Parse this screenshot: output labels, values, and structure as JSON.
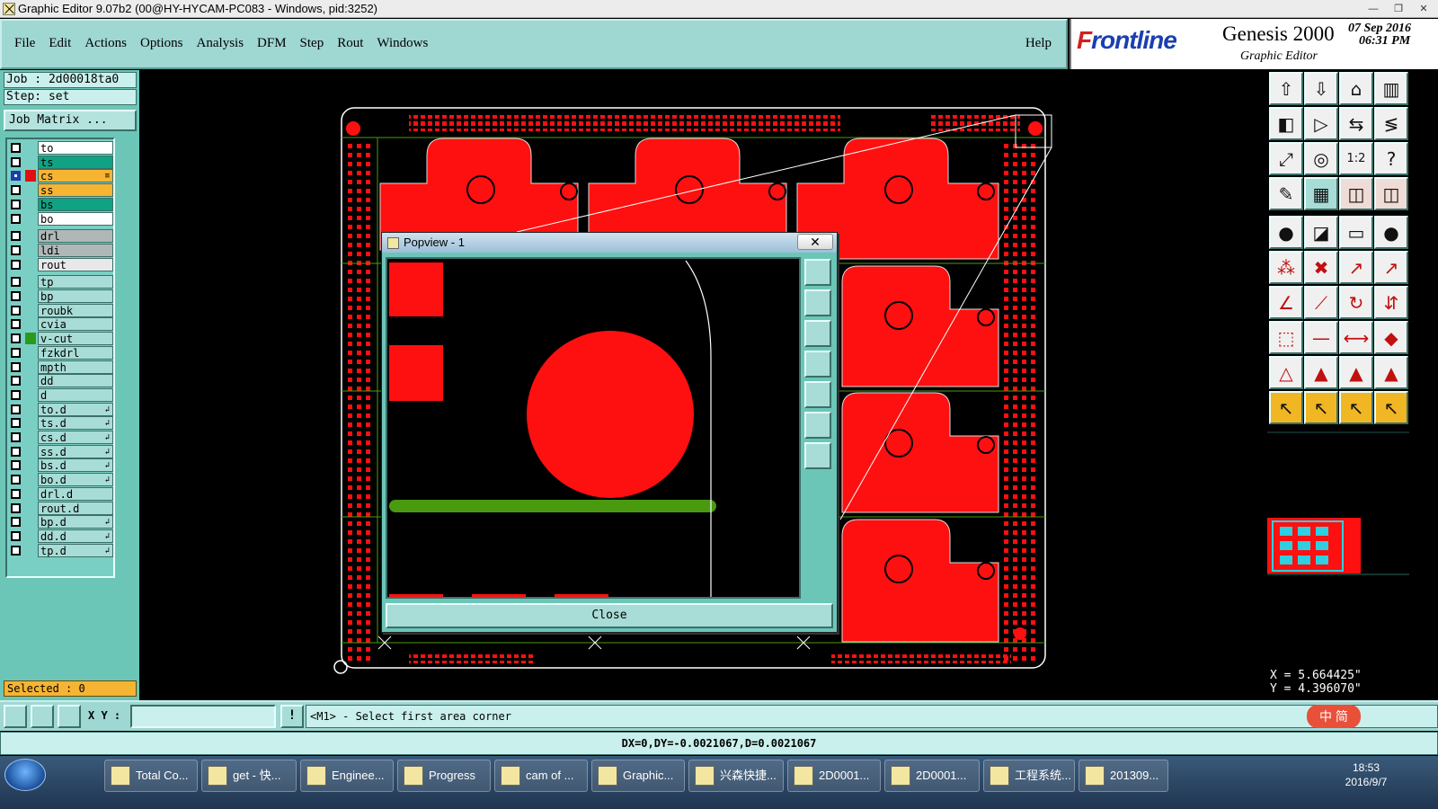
{
  "window": {
    "title": "Graphic Editor 9.07b2 (00@HY-HYCAM-PC083 - Windows, pid:3252)",
    "buttons": [
      "—",
      "❐",
      "✕"
    ]
  },
  "menu": {
    "items": [
      "File",
      "Edit",
      "Actions",
      "Options",
      "Analysis",
      "DFM",
      "Step",
      "Rout",
      "Windows"
    ],
    "help": "Help"
  },
  "brand": {
    "logo_f": "F",
    "logo_rest": "rontline",
    "product": "Genesis 2000",
    "subtitle": "Graphic Editor",
    "date": "07 Sep 2016",
    "time": "06:31 PM"
  },
  "left": {
    "job": "Job : 2d00018ta0",
    "step": "Step: set",
    "job_matrix": "Job Matrix ...",
    "selected": "Selected : 0",
    "layers": [
      {
        "name": "to",
        "color": "#ffffff",
        "mark": ""
      },
      {
        "name": "ts",
        "color": "#0fa383",
        "mark": ""
      },
      {
        "name": "cs",
        "color": "#f6b433",
        "mark": "#e01010",
        "sel": true,
        "arr": "≡"
      },
      {
        "name": "ss",
        "color": "#f6b433",
        "mark": ""
      },
      {
        "name": "bs",
        "color": "#0fa383",
        "mark": ""
      },
      {
        "name": "bo",
        "color": "#ffffff",
        "mark": ""
      },
      {
        "name": "drl",
        "color": "#b0b8b7",
        "mark": "",
        "gap": true
      },
      {
        "name": "ldi",
        "color": "#b0b8b7",
        "mark": ""
      },
      {
        "name": "rout",
        "color": "#e8e8e8",
        "mark": ""
      },
      {
        "name": "tp",
        "color": "#a8dcd6",
        "mark": "",
        "gap": true
      },
      {
        "name": "bp",
        "color": "#a8dcd6",
        "mark": ""
      },
      {
        "name": "roubk",
        "color": "#a8dcd6",
        "mark": ""
      },
      {
        "name": "cvia",
        "color": "#a8dcd6",
        "mark": ""
      },
      {
        "name": "v-cut",
        "color": "#a8dcd6",
        "mark": "#2a9a1a"
      },
      {
        "name": "fzkdrl",
        "color": "#a8dcd6",
        "mark": ""
      },
      {
        "name": "mpth",
        "color": "#a8dcd6",
        "mark": ""
      },
      {
        "name": "dd",
        "color": "#a8dcd6",
        "mark": ""
      },
      {
        "name": "d",
        "color": "#a8dcd6",
        "mark": ""
      },
      {
        "name": "to.d",
        "color": "#a8dcd6",
        "mark": "",
        "arr": "↲"
      },
      {
        "name": "ts.d",
        "color": "#a8dcd6",
        "mark": "",
        "arr": "↲"
      },
      {
        "name": "cs.d",
        "color": "#a8dcd6",
        "mark": "",
        "arr": "↲"
      },
      {
        "name": "ss.d",
        "color": "#a8dcd6",
        "mark": "",
        "arr": "↲"
      },
      {
        "name": "bs.d",
        "color": "#a8dcd6",
        "mark": "",
        "arr": "↲"
      },
      {
        "name": "bo.d",
        "color": "#a8dcd6",
        "mark": "",
        "arr": "↲"
      },
      {
        "name": "drl.d",
        "color": "#a8dcd6",
        "mark": ""
      },
      {
        "name": "rout.d",
        "color": "#a8dcd6",
        "mark": ""
      },
      {
        "name": "bp.d",
        "color": "#a8dcd6",
        "mark": "",
        "arr": "↲"
      },
      {
        "name": "dd.d",
        "color": "#a8dcd6",
        "mark": "",
        "arr": "↲"
      },
      {
        "name": "tp.d",
        "color": "#a8dcd6",
        "mark": "",
        "arr": "↲"
      }
    ]
  },
  "popview": {
    "title": "Popview - 1",
    "close_x": "✕",
    "close_button": "Close"
  },
  "coords": {
    "x": "X = 5.664425\"",
    "y": "Y = 4.396070\""
  },
  "command": {
    "xy_label": "X Y :",
    "xy_value": "",
    "prompt": "<M1> - Select first area corner"
  },
  "status": "DX=0,DY=-0.0021067,D=0.0021067",
  "taskbar": {
    "items": [
      "Total Co...",
      "get - 快...",
      "Enginee...",
      "Progress",
      "cam of ...",
      "Graphic...",
      "兴森快捷...",
      "2D0001...",
      "2D0001...",
      "工程系统...",
      "201309..."
    ],
    "clock_time": "18:53",
    "clock_date": "2016/9/7",
    "ime": "中 简"
  },
  "colors": {
    "copper": "#ff1010",
    "panel": "#6cc6b8",
    "vcut": "#4a9a10",
    "accent": "#1b3fb0"
  }
}
